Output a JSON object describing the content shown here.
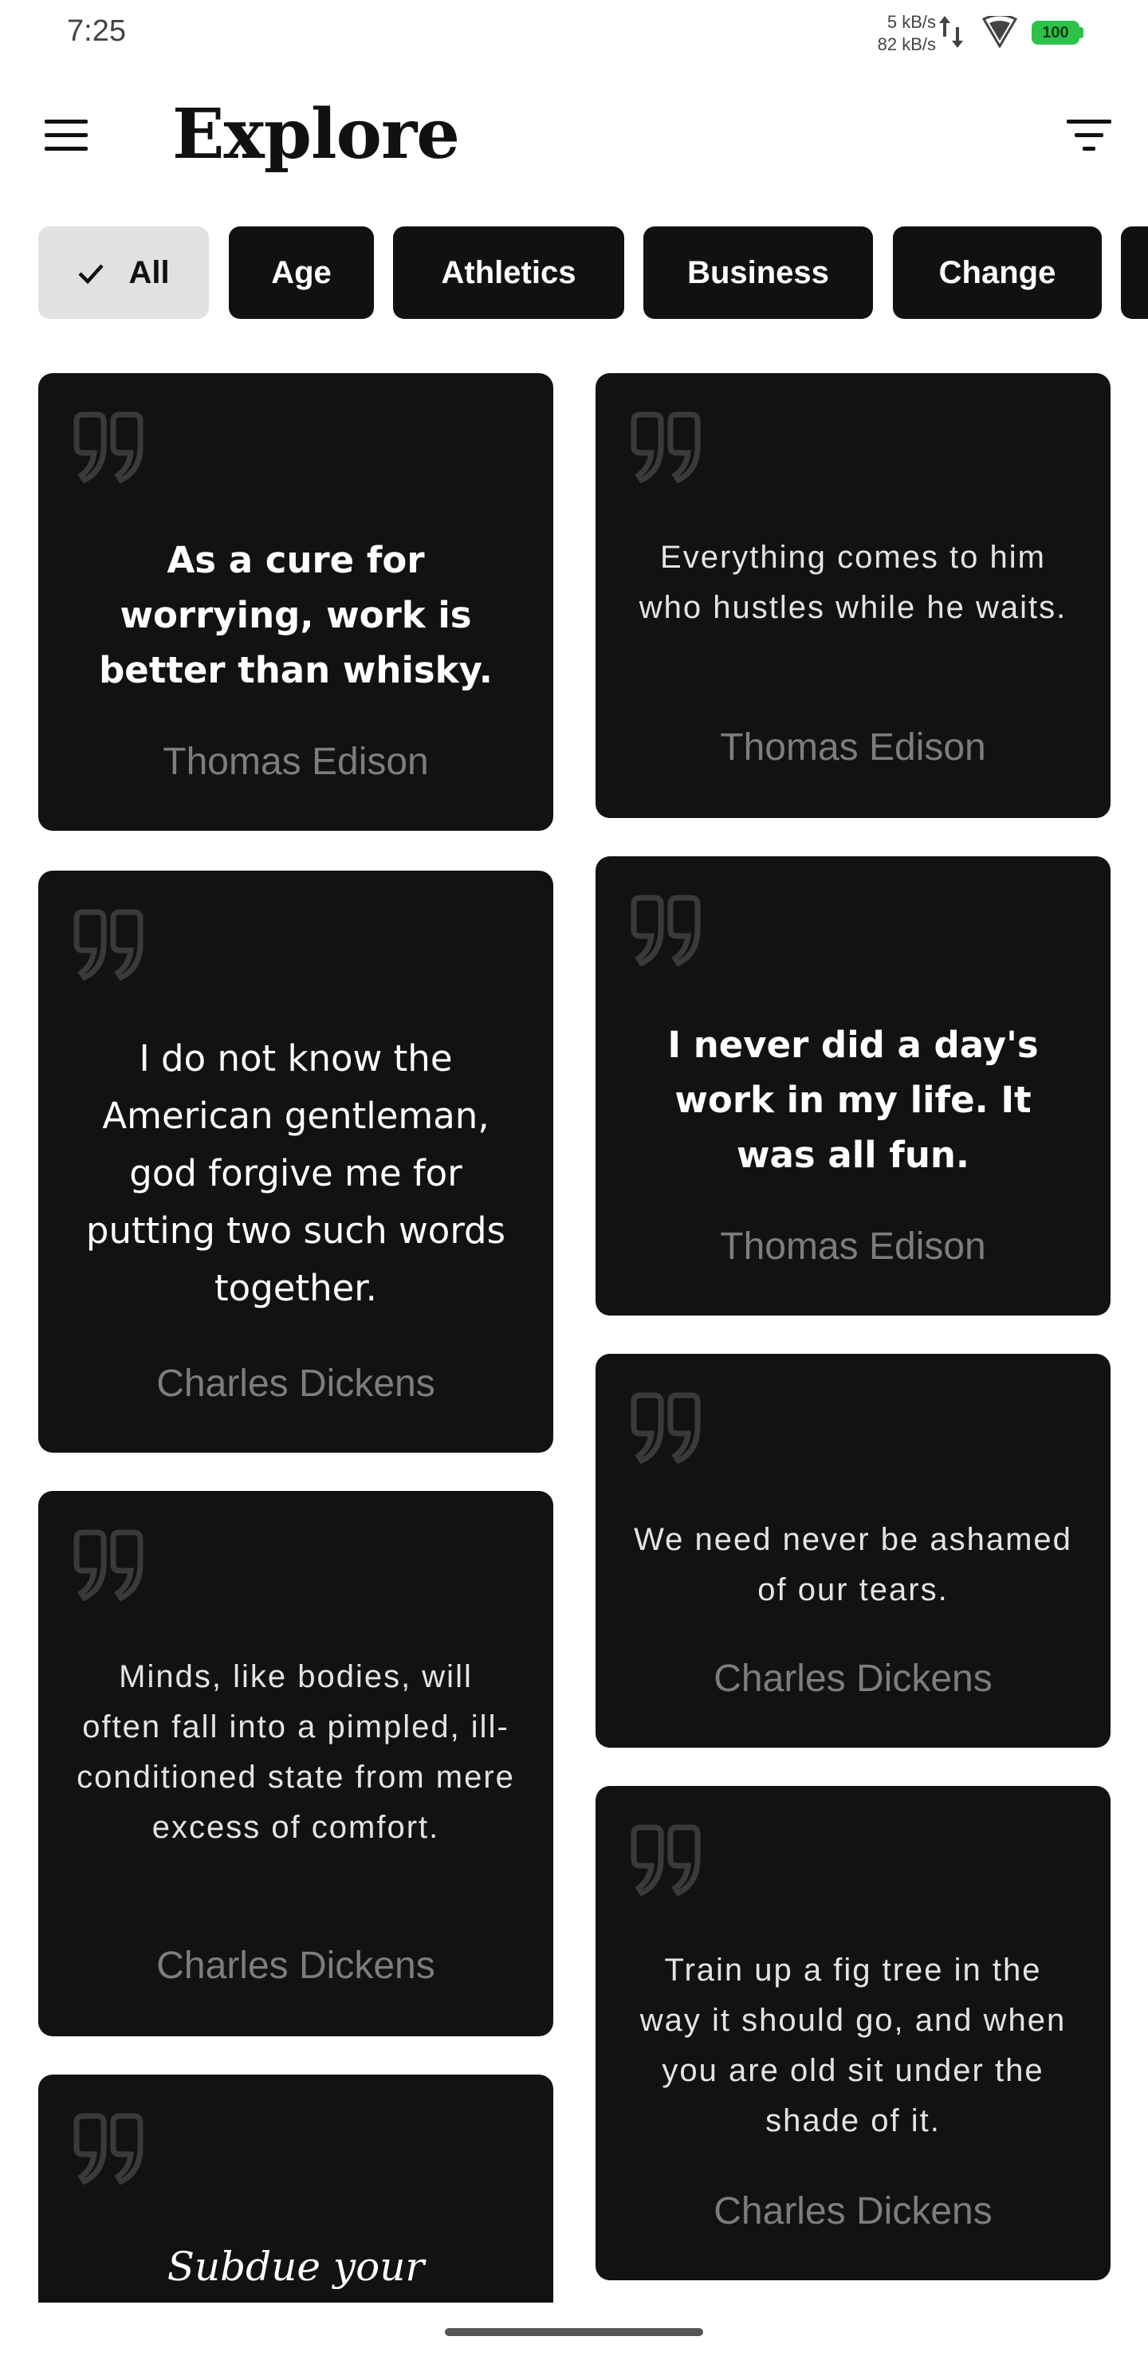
{
  "status_bar": {
    "time": "7:25",
    "upload_speed": "5 kB/s",
    "download_speed": "82 kB/s",
    "battery": "100",
    "battery_color": "#2ec24a"
  },
  "header": {
    "title": "Explore",
    "menu_icon": "hamburger-menu-icon",
    "filter_icon": "filter-sort-icon"
  },
  "chips": [
    {
      "label": "All",
      "selected": true
    },
    {
      "label": "Age",
      "selected": false
    },
    {
      "label": "Athletics",
      "selected": false
    },
    {
      "label": "Business",
      "selected": false
    },
    {
      "label": "Change",
      "selected": false
    }
  ],
  "quotes": [
    {
      "text": "As a cure for worrying, work is better than whisky.",
      "author": "Thomas Edison"
    },
    {
      "text": "Everything comes to him who hustles while he waits.",
      "author": "Thomas Edison"
    },
    {
      "text": "I do not know the American gentleman, god forgive me for putting two such words together.",
      "author": "Charles Dickens"
    },
    {
      "text": "I never did a day's work in my life.  It was all fun.",
      "author": "Thomas Edison"
    },
    {
      "text": "We need never be ashamed of our tears.",
      "author": "Charles Dickens"
    },
    {
      "text": "Minds, like bodies, will often fall into a pimpled, ill-conditioned state from mere excess of comfort.",
      "author": "Charles Dickens"
    },
    {
      "text": "Train up a fig tree in the way it should go, and when you are old sit under the shade of it.",
      "author": "Charles Dickens"
    },
    {
      "text": "Subdue your appetites,",
      "author": ""
    }
  ],
  "colors": {
    "card_background": "#121212",
    "author_text": "#7d7d7d",
    "quote_mark": "#3a3a3a",
    "chip_selected_background": "#e1e1e1",
    "chip_background": "#111111"
  }
}
